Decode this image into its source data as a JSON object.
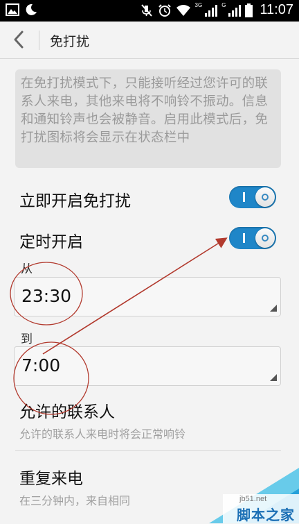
{
  "status_bar": {
    "time": "11:07",
    "network_1": "3G",
    "network_2": "G",
    "icons": [
      "image-icon",
      "moon-icon",
      "mute-icon",
      "alarm-icon",
      "wifi-icon",
      "signal-icon",
      "signal-icon",
      "battery-icon"
    ]
  },
  "app_bar": {
    "title": "免打扰",
    "back_icon": "chevron-left-icon"
  },
  "description": "在免打扰模式下，只能接听经过您许可的联系人来电，其他来电将不响铃不振动。信息和通知铃声也会被静音。启用此模式后，免打扰图标将会显示在状态栏中",
  "settings": {
    "immediate": {
      "label": "立即开启免打扰",
      "enabled": true
    },
    "scheduled": {
      "label": "定时开启",
      "enabled": true
    },
    "from": {
      "label": "从",
      "value": "23:30"
    },
    "to": {
      "label": "到",
      "value": "7:00"
    },
    "allowed_contacts": {
      "title": "允许的联系人",
      "subtitle": "允许的联系人来电时将会正常响铃"
    },
    "repeat_calls": {
      "title": "重复来电",
      "subtitle": "在三分钟内，来自相同"
    }
  },
  "watermark": {
    "site": "jb51.net",
    "name": "脚本之家"
  },
  "colors": {
    "toggle_on": "#1f86c8",
    "annotation": "#b23a2e",
    "status_bar": "#000000"
  }
}
